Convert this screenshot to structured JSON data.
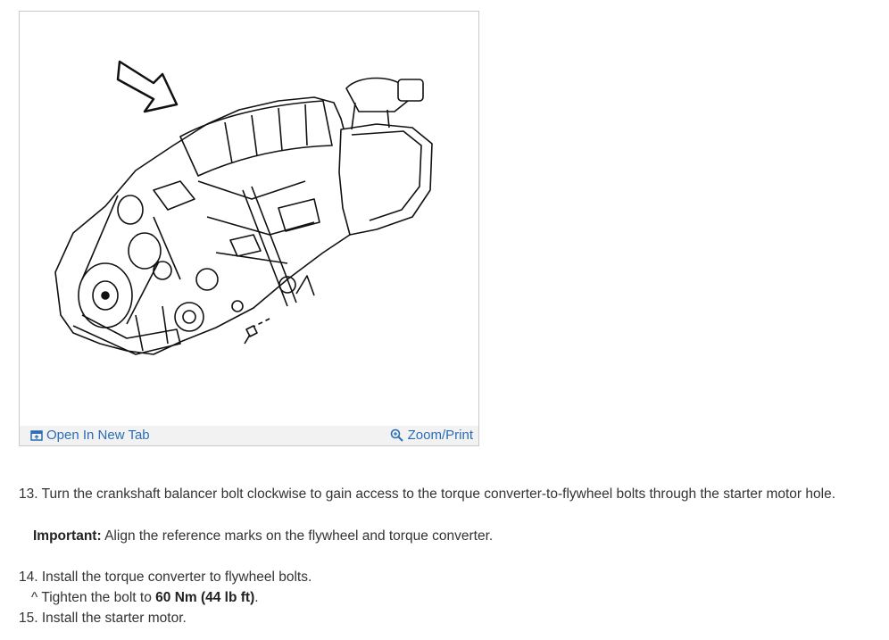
{
  "figure": {
    "open_new_tab_label": "Open In New Tab",
    "zoom_print_label": "Zoom/Print",
    "open_icon": "new-window-icon",
    "zoom_icon": "magnifier-icon",
    "link_color": "#2a6db5"
  },
  "steps": {
    "s13": {
      "number": "13.",
      "text": "Turn the crankshaft balancer bolt clockwise to gain access to the torque converter-to-flywheel bolts through the starter motor hole."
    },
    "important": {
      "label": "Important:",
      "text": "Align the reference marks on the flywheel and torque converter."
    },
    "s14": {
      "number": "14.",
      "text": "Install the torque converter to flywheel bolts."
    },
    "s14_sub": {
      "bullet": "^",
      "text_before": "Tighten the bolt to",
      "value": "60 Nm (44 lb ft)",
      "text_after": "."
    },
    "s15": {
      "number": "15.",
      "text": "Install the starter motor."
    }
  }
}
